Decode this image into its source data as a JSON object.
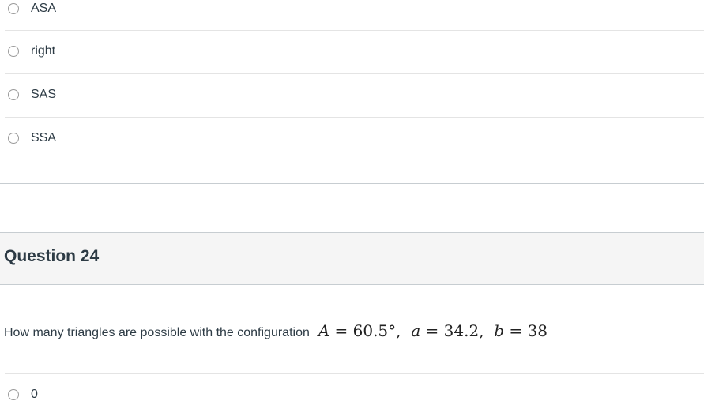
{
  "previous_question": {
    "answers": [
      {
        "label": "ASA",
        "selected": false
      },
      {
        "label": "right",
        "selected": false
      },
      {
        "label": "SAS",
        "selected": false
      },
      {
        "label": "SSA",
        "selected": false
      }
    ]
  },
  "question": {
    "title": "Question 24",
    "text": "How many triangles are possible with the configuration",
    "math": {
      "A_var": "A",
      "A_val": "60.5°",
      "a_var": "a",
      "a_val": "34.2",
      "b_var": "b",
      "b_val": "38"
    },
    "answers": [
      {
        "label": "0",
        "selected": false
      }
    ]
  }
}
